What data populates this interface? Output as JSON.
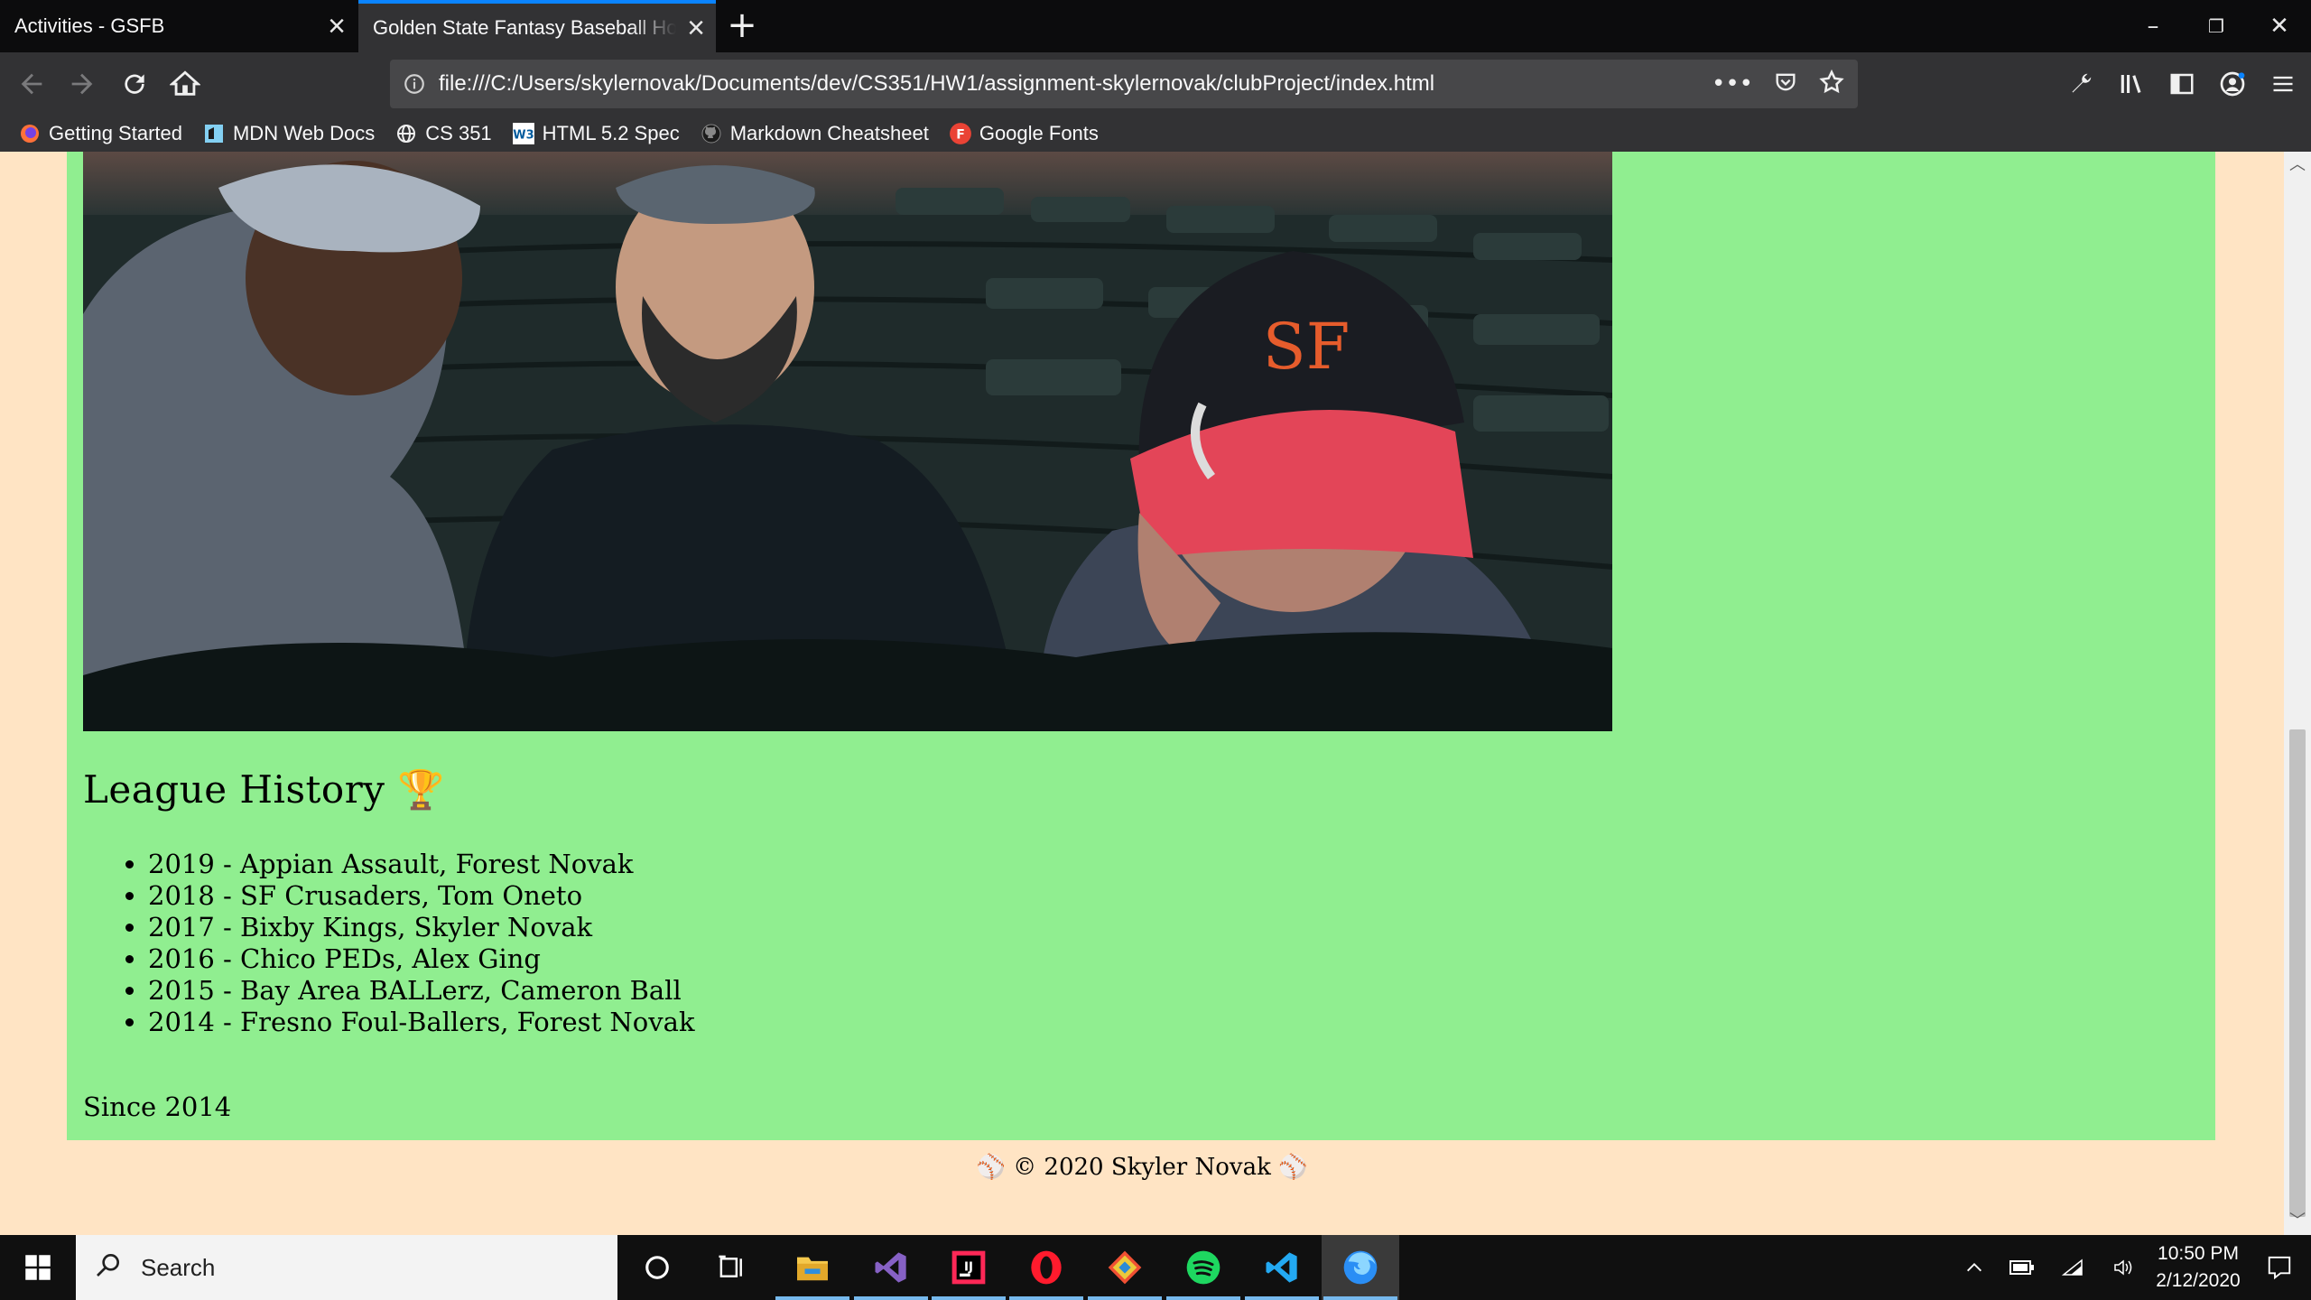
{
  "browser": {
    "tabs": [
      {
        "label": "Activities - GSFB",
        "active": false
      },
      {
        "label": "Golden State Fantasy Baseball Home",
        "active": true
      }
    ],
    "url": "file:///C:/Users/skylernovak/Documents/dev/CS351/HW1/assignment-skylernovak/clubProject/index.html",
    "bookmarks": [
      {
        "label": "Getting Started",
        "icon": "firefox-icon"
      },
      {
        "label": "MDN Web Docs",
        "icon": "mdn-icon"
      },
      {
        "label": "CS 351",
        "icon": "globe-icon"
      },
      {
        "label": "HTML 5.2 Spec",
        "icon": "w3c-icon"
      },
      {
        "label": "Markdown Cheatsheet",
        "icon": "github-icon"
      },
      {
        "label": "Google Fonts",
        "icon": "google-fonts-icon"
      }
    ]
  },
  "page": {
    "history_title": "League History 🏆",
    "history": [
      "2019 - Appian Assault, Forest Novak",
      "2018 - SF Crusaders, Tom Oneto",
      "2017 - Bixby Kings, Skyler Novak",
      "2016 - Chico PEDs, Alex Ging",
      "2015 - Bay Area BALLerz, Cameron Ball",
      "2014 - Fresno Foul-Ballers, Forest Novak"
    ],
    "since": "Since 2014",
    "footer": "⚾ © 2020 Skyler Novak ⚾"
  },
  "taskbar": {
    "search_placeholder": "Search",
    "time": "10:50 PM",
    "date": "2/12/2020",
    "apps": [
      "cortana-icon",
      "task-view-icon",
      "file-explorer-icon",
      "visual-studio-icon",
      "intellij-icon",
      "opera-icon",
      "git-kraken-icon",
      "spotify-icon",
      "vscode-icon",
      "firefox-icon"
    ]
  },
  "colors": {
    "page_background": "#ffe4c4",
    "main_background": "#90ee90",
    "tab_accent": "#0a84ff"
  }
}
